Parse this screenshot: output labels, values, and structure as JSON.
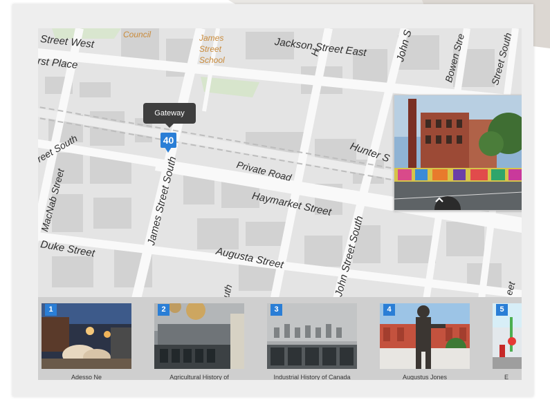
{
  "map": {
    "labels": {
      "council": "Council",
      "james_street_school": [
        "James",
        "Street",
        "School"
      ],
      "street_west": "Street West",
      "rst_place": "rst Place",
      "jackson_street_east": "Jackson Street East",
      "john_st": "John S",
      "bowen": "Bowen Stre",
      "street_south_ne": "Street South",
      "hunter": "Hunter S",
      "private_road": "Private Road",
      "haymarket": "Haymarket Street",
      "reet_south": "reet South",
      "macnab": "MacNab Street",
      "james_street_south": "James Street South",
      "duke": "Duke Street",
      "augusta": "Augusta Street",
      "john_street_south": "John Street South",
      "h_fragment": "H",
      "uth_fragment": "uth",
      "eet_fragment": "eet"
    },
    "tooltip": "Gateway",
    "marker": "40",
    "popup_expand_icon": "chevron-up-icon"
  },
  "carousel": {
    "items": [
      {
        "num": "1",
        "caption": "Adesso Ne"
      },
      {
        "num": "2",
        "caption": "Agricultural History of"
      },
      {
        "num": "3",
        "caption": "Industrial History of Canada"
      },
      {
        "num": "4",
        "caption": "Augustus Jones"
      },
      {
        "num": "5",
        "caption": "E"
      }
    ]
  },
  "colors": {
    "accent": "#2a7ed6",
    "map_bg": "#e4e4e4",
    "road": "#f9f9f9",
    "building": "#d4d4d4"
  }
}
